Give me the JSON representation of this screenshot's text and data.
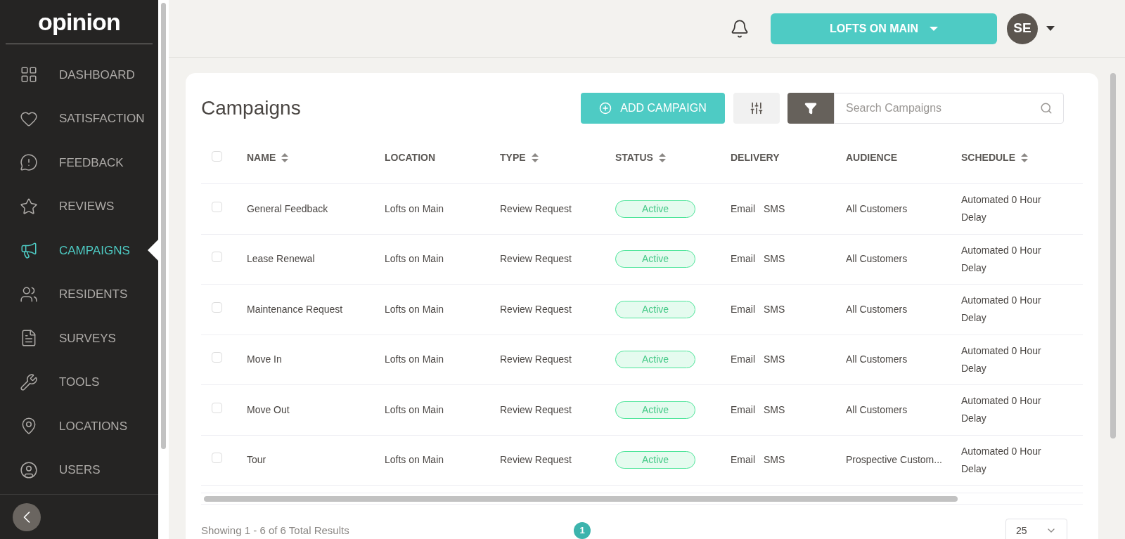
{
  "sidebar": {
    "logo": "opinion",
    "items": [
      {
        "label": "DASHBOARD",
        "selected": false
      },
      {
        "label": "SATISFACTION",
        "selected": false
      },
      {
        "label": "FEEDBACK",
        "selected": false
      },
      {
        "label": "REVIEWS",
        "selected": false
      },
      {
        "label": "CAMPAIGNS",
        "selected": true
      },
      {
        "label": "RESIDENTS",
        "selected": false
      },
      {
        "label": "SURVEYS",
        "selected": false
      },
      {
        "label": "TOOLS",
        "selected": false
      },
      {
        "label": "LOCATIONS",
        "selected": false
      },
      {
        "label": "USERS",
        "selected": false
      }
    ]
  },
  "topbar": {
    "location": "LOFTS ON MAIN",
    "avatar": "SE"
  },
  "page": {
    "title": "Campaigns",
    "add_button": "ADD CAMPAIGN",
    "search": {
      "placeholder": "Search Campaigns"
    }
  },
  "table": {
    "select_all": {
      "checked": false
    },
    "columns": [
      {
        "label": "NAME",
        "sortable": true
      },
      {
        "label": "LOCATION",
        "sortable": false
      },
      {
        "label": "TYPE",
        "sortable": true
      },
      {
        "label": "STATUS",
        "sortable": true
      },
      {
        "label": "DELIVERY",
        "sortable": false
      },
      {
        "label": "AUDIENCE",
        "sortable": false
      },
      {
        "label": "SCHEDULE",
        "sortable": true
      }
    ],
    "rows": [
      {
        "checked": false,
        "name": "General Feedback",
        "location": "Lofts on Main",
        "type": "Review Request",
        "status": "Active",
        "delivery": [
          "Email",
          "SMS"
        ],
        "audience": "All Customers",
        "schedule": "Automated 0 Hour Delay"
      },
      {
        "checked": false,
        "name": "Lease Renewal",
        "location": "Lofts on Main",
        "type": "Review Request",
        "status": "Active",
        "delivery": [
          "Email",
          "SMS"
        ],
        "audience": "All Customers",
        "schedule": "Automated 0 Hour Delay"
      },
      {
        "checked": false,
        "name": "Maintenance Request",
        "location": "Lofts on Main",
        "type": "Review Request",
        "status": "Active",
        "delivery": [
          "Email",
          "SMS"
        ],
        "audience": "All Customers",
        "schedule": "Automated 0 Hour Delay"
      },
      {
        "checked": false,
        "name": "Move In",
        "location": "Lofts on Main",
        "type": "Review Request",
        "status": "Active",
        "delivery": [
          "Email",
          "SMS"
        ],
        "audience": "All Customers",
        "schedule": "Automated 0 Hour Delay"
      },
      {
        "checked": false,
        "name": "Move Out",
        "location": "Lofts on Main",
        "type": "Review Request",
        "status": "Active",
        "delivery": [
          "Email",
          "SMS"
        ],
        "audience": "All Customers",
        "schedule": "Automated 0 Hour Delay"
      },
      {
        "checked": false,
        "name": "Tour",
        "location": "Lofts on Main",
        "type": "Review Request",
        "status": "Active",
        "delivery": [
          "Email",
          "SMS"
        ],
        "audience": "Prospective Custom...",
        "schedule": "Automated 0 Hour Delay"
      }
    ]
  },
  "footer": {
    "summary": "Showing 1 - 6 of 6 Total Results",
    "pages": [
      {
        "label": "1",
        "selected": true
      }
    ],
    "per_page": "25"
  }
}
